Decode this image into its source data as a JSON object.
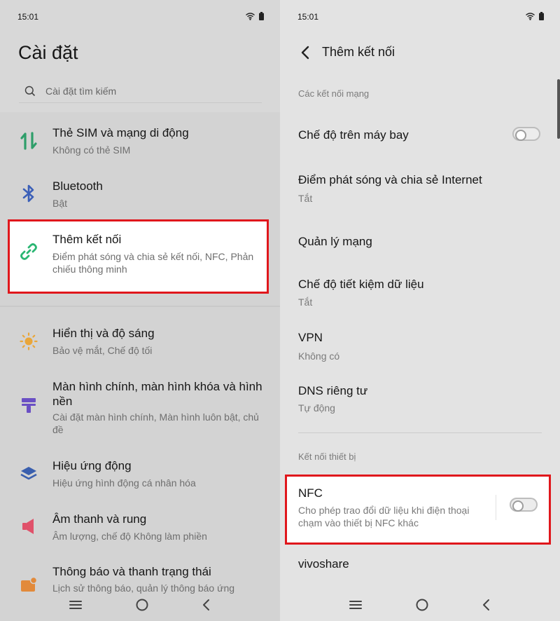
{
  "status": {
    "time": "15:01"
  },
  "left": {
    "title": "Cài đặt",
    "search_placeholder": "Cài đặt tìm kiếm",
    "items": [
      {
        "title": "Thẻ SIM và mạng di động",
        "subtitle": "Không có thẻ SIM",
        "icon": "sim-icon"
      },
      {
        "title": "Bluetooth",
        "subtitle": "Bật",
        "icon": "bluetooth-icon"
      },
      {
        "title": "Thêm kết nối",
        "subtitle": "Điểm phát sóng và chia sẻ kết nối, NFC, Phản chiếu thông minh",
        "icon": "link-icon"
      },
      {
        "title": "Hiển thị và độ sáng",
        "subtitle": "Bảo vệ mắt, Chế độ tối",
        "icon": "brightness-icon"
      },
      {
        "title": "Màn hình chính, màn hình khóa và hình nền",
        "subtitle": "Cài đặt màn hình chính, Màn hình luôn bật, chủ đề",
        "icon": "wallpaper-icon"
      },
      {
        "title": "Hiệu ứng động",
        "subtitle": "Hiệu ứng hình động cá nhân hóa",
        "icon": "animation-icon"
      },
      {
        "title": "Âm thanh và rung",
        "subtitle": "Âm lượng, chế độ Không làm phiền",
        "icon": "sound-icon"
      },
      {
        "title": "Thông báo và thanh trạng thái",
        "subtitle": "Lịch sử thông báo, quản lý thông báo ứng",
        "icon": "notification-icon"
      }
    ]
  },
  "right": {
    "title": "Thêm kết nối",
    "section_network": "Các kết nối mạng",
    "airplane": {
      "title": "Chế độ trên máy bay",
      "enabled": false
    },
    "hotspot": {
      "title": "Điểm phát sóng và chia sẻ Internet",
      "subtitle": "Tắt"
    },
    "network_mgmt": {
      "title": "Quản lý mạng"
    },
    "data_saver": {
      "title": "Chế độ tiết kiệm dữ liệu",
      "subtitle": "Tắt"
    },
    "vpn": {
      "title": "VPN",
      "subtitle": "Không có"
    },
    "dns": {
      "title": "DNS riêng tư",
      "subtitle": "Tự động"
    },
    "section_device": "Kết nối thiết bị",
    "nfc": {
      "title": "NFC",
      "subtitle": "Cho phép trao đổi dữ liệu khi điện thoại chạm vào thiết bị NFC khác",
      "enabled": false
    },
    "vivoshare": {
      "title": "vivoshare"
    }
  },
  "colors": {
    "highlight": "#e0171c",
    "accent": "#2bb673"
  }
}
